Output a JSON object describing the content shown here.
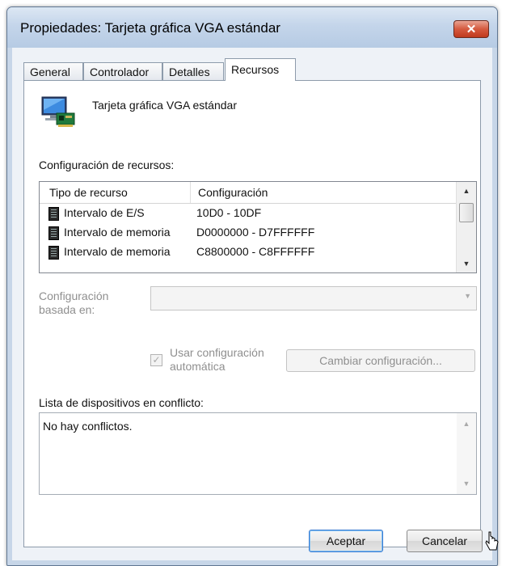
{
  "window": {
    "title": "Propiedades: Tarjeta gráfica VGA estándar",
    "close_glyph": "✕"
  },
  "tabs": [
    {
      "label": "General"
    },
    {
      "label": "Controlador"
    },
    {
      "label": "Detalles"
    },
    {
      "label": "Recursos",
      "active": true
    }
  ],
  "device": {
    "name": "Tarjeta gráfica VGA estándar",
    "icon": "display-adapter-icon"
  },
  "resources": {
    "label": "Configuración de recursos:",
    "columns": [
      "Tipo de recurso",
      "Configuración"
    ],
    "rows": [
      {
        "type": "Intervalo de E/S",
        "config": "10D0 - 10DF",
        "icon": "memory-chip-icon"
      },
      {
        "type": "Intervalo de memoria",
        "config": "D0000000 - D7FFFFFF",
        "icon": "memory-chip-icon"
      },
      {
        "type": "Intervalo de memoria",
        "config": "C8800000 - C8FFFFFF",
        "icon": "memory-chip-icon"
      }
    ]
  },
  "based_on": {
    "label_line1": "Configuración",
    "label_line2": "basada en:",
    "value": ""
  },
  "auto": {
    "label_line1": "Usar configuración",
    "label_line2": "automática",
    "checked": true
  },
  "change_button": "Cambiar configuración...",
  "conflicts": {
    "label": "Lista de dispositivos en conflicto:",
    "text": "No hay conflictos."
  },
  "buttons": {
    "ok": "Aceptar",
    "cancel": "Cancelar"
  },
  "colors": {
    "accent": "#3b7bd1",
    "close": "#c03a1e"
  }
}
